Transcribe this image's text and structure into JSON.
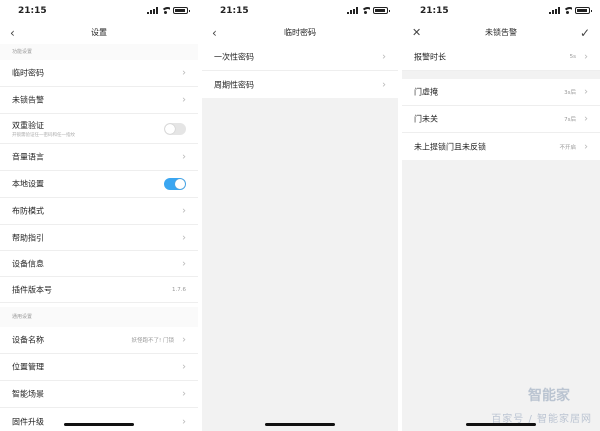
{
  "status_time": "21:15",
  "screen1": {
    "title": "设置",
    "section1": "功能设置",
    "items": [
      {
        "label": "临时密码"
      },
      {
        "label": "未锁告警"
      },
      {
        "label": "双重验证",
        "sub": "开锁需验证任一密码和任一指纹"
      },
      {
        "label": "音量语言"
      },
      {
        "label": "本地设置"
      },
      {
        "label": "布防模式"
      },
      {
        "label": "帮助指引"
      },
      {
        "label": "设备信息"
      },
      {
        "label": "插件版本号",
        "value": "1.7.6"
      }
    ],
    "section2": "通用设置",
    "items2": [
      {
        "label": "设备名称",
        "value": "妖怪跑不了! 门锁"
      },
      {
        "label": "位置管理"
      },
      {
        "label": "智能场景"
      },
      {
        "label": "固件升级"
      }
    ]
  },
  "screen2": {
    "title": "临时密码",
    "items": [
      {
        "label": "一次性密码"
      },
      {
        "label": "周期性密码"
      }
    ]
  },
  "screen3": {
    "title": "未锁告警",
    "items": [
      {
        "label": "报警时长",
        "value": "5s"
      },
      {
        "label": "门虚掩",
        "value": "3s后"
      },
      {
        "label": "门未关",
        "value": "7s后"
      },
      {
        "label": "未上提锁门且未反锁",
        "value": "不开启"
      }
    ]
  },
  "watermark": {
    "logo": "智能家",
    "text": "百家号 / 智能家居网"
  }
}
